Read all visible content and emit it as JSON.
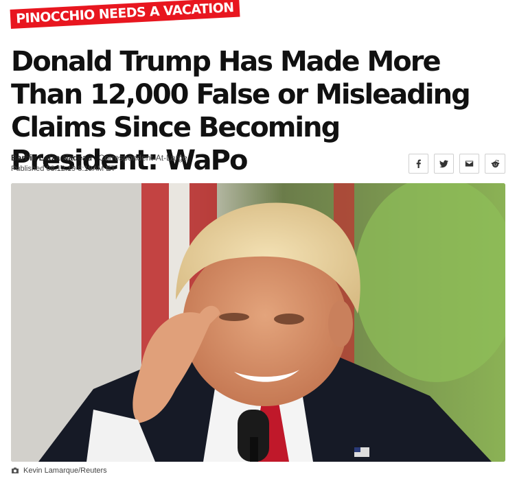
{
  "rubric": {
    "label": "PINOCCHIO NEEDS A VACATION",
    "color": "#e8161f"
  },
  "article": {
    "headline": "Donald Trump Has Made More Than 12,000 False or Misleading Claims Since Becoming President: WaPo",
    "author": "Barbie Latza Nadeau",
    "author_role": "Correspondent-At-Large",
    "published": "Published 08.12.19 8:19AM ET"
  },
  "share": {
    "icons": [
      "facebook-icon",
      "twitter-icon",
      "email-icon",
      "reddit-icon"
    ]
  },
  "photo": {
    "credit": "Kevin Lamarque/Reuters",
    "credit_icon": "camera-icon"
  }
}
